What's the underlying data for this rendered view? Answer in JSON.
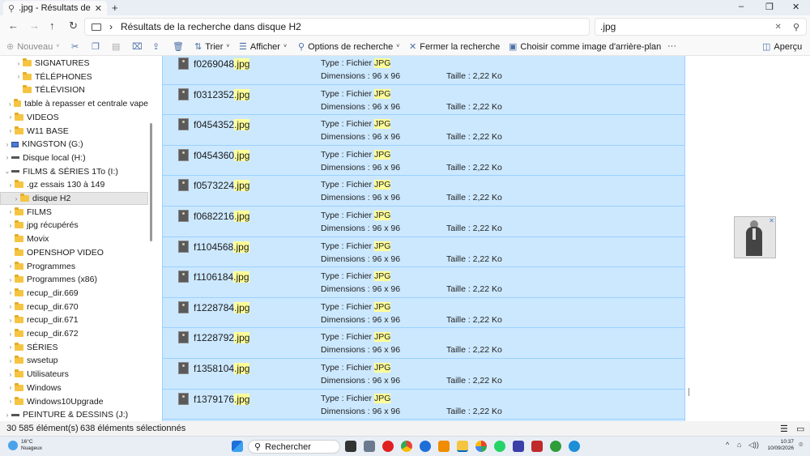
{
  "window": {
    "tab_title": ".jpg - Résultats de",
    "tab_close": "✕",
    "new_tab": "+",
    "minimize": "–",
    "maximize": "❐",
    "close": "✕"
  },
  "address": {
    "back": "←",
    "forward": "→",
    "up": "↑",
    "refresh": "↻",
    "crumb_separator": "›",
    "breadcrumb": "Résultats de la recherche dans disque H2",
    "search_value": ".jpg",
    "search_clear": "✕",
    "search_icon": "⚲"
  },
  "toolbar": {
    "new_label": "Nouveau",
    "sort_label": "Trier",
    "view_label": "Afficher",
    "search_options_label": "Options de recherche",
    "close_search_label": "Fermer la recherche",
    "set_background_label": "Choisir comme image d'arrière-plan",
    "more_label": "···",
    "preview_label": "Aperçu"
  },
  "sidebar": {
    "items": [
      {
        "label": "SIGNATURES",
        "kind": "folder"
      },
      {
        "label": "TÉLÉPHONES",
        "kind": "folder"
      },
      {
        "label": "TÉLÉVISION",
        "kind": "folder"
      },
      {
        "label": "table à repasser et centrale vape",
        "kind": "folder"
      },
      {
        "label": "VIDEOS",
        "kind": "folder"
      },
      {
        "label": "W11 BASE",
        "kind": "folder"
      },
      {
        "label": "KINGSTON (G:)",
        "kind": "usb"
      },
      {
        "label": "Disque local (H:)",
        "kind": "drive"
      },
      {
        "label": "FILMS & SÉRIES 1To (I:)",
        "kind": "drive"
      },
      {
        "label": ".gz essais 130 à 149",
        "kind": "folder"
      },
      {
        "label": "disque H2",
        "kind": "folder",
        "selected": true
      },
      {
        "label": "FILMS",
        "kind": "folder"
      },
      {
        "label": "jpg récupérés",
        "kind": "folder"
      },
      {
        "label": "Movix",
        "kind": "folder"
      },
      {
        "label": "OPENSHOP VIDEO",
        "kind": "folder"
      },
      {
        "label": "Programmes",
        "kind": "folder"
      },
      {
        "label": "Programmes (x86)",
        "kind": "folder"
      },
      {
        "label": "recup_dir.669",
        "kind": "folder"
      },
      {
        "label": "recup_dir.670",
        "kind": "folder"
      },
      {
        "label": "recup_dir.671",
        "kind": "folder"
      },
      {
        "label": "recup_dir.672",
        "kind": "folder"
      },
      {
        "label": "SÉRIES",
        "kind": "folder"
      },
      {
        "label": "swsetup",
        "kind": "folder"
      },
      {
        "label": "Utilisateurs",
        "kind": "folder"
      },
      {
        "label": "Windows",
        "kind": "folder"
      },
      {
        "label": "Windows10Upgrade",
        "kind": "folder"
      },
      {
        "label": "PEINTURE & DESSINS (J:)",
        "kind": "drive"
      }
    ]
  },
  "results": {
    "type_prefix": "Type : Fichier",
    "type_value": "JPG",
    "dim_label": "Dimensions : 96 x 96",
    "size_label": "Taille : 2,22 Ko",
    "items": [
      {
        "name": "f0269048",
        "ext": ".jpg"
      },
      {
        "name": "f0312352",
        "ext": ".jpg"
      },
      {
        "name": "f0454352",
        "ext": ".jpg"
      },
      {
        "name": "f0454360",
        "ext": ".jpg"
      },
      {
        "name": "f0573224",
        "ext": ".jpg"
      },
      {
        "name": "f0682216",
        "ext": ".jpg"
      },
      {
        "name": "f1104568",
        "ext": ".jpg"
      },
      {
        "name": "f1106184",
        "ext": ".jpg"
      },
      {
        "name": "f1228784",
        "ext": ".jpg"
      },
      {
        "name": "f1228792",
        "ext": ".jpg"
      },
      {
        "name": "f1358104",
        "ext": ".jpg"
      },
      {
        "name": "f1379176",
        "ext": ".jpg"
      }
    ]
  },
  "preview": {
    "close": "✕"
  },
  "status": {
    "item_count": "30 585 élément(s)",
    "selected_count": "638 éléments sélectionnés",
    "details_view": "☰",
    "tiles_view": "▭"
  },
  "taskbar": {
    "temperature": "16°C",
    "weather": "Nuageux",
    "search_label": "Rechercher",
    "search_icon": "⚲",
    "time": "10:37",
    "date": "10/09/2026",
    "tray_up": "^",
    "tray_net": "⌂",
    "tray_vol": "◁))",
    "tray_notif": "⌾",
    "colors": {
      "accent": "#0067c0",
      "selection": "#cce8ff"
    }
  }
}
